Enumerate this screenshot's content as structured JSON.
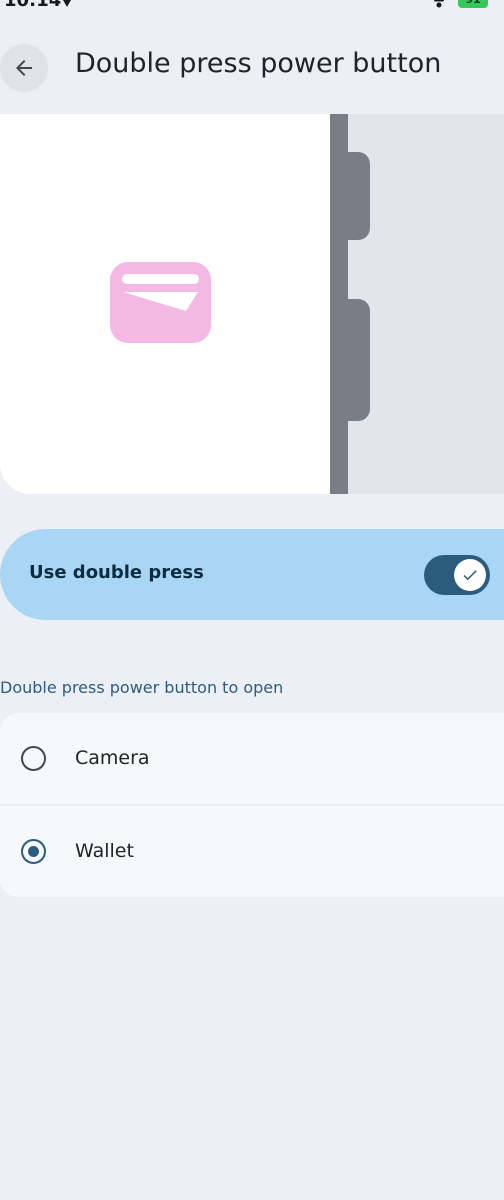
{
  "status_bar": {
    "time": "10:14",
    "battery": "91"
  },
  "header": {
    "title": "Double press power button",
    "back_icon": "arrow-left-icon"
  },
  "illustration": {
    "icon": "wallet-card-icon",
    "colors": {
      "icon_pink": "#f4b8e4",
      "phone_edge": "#777e86",
      "phone_side": "#e2e5ec"
    }
  },
  "toggle": {
    "label": "Use double press",
    "checked": true,
    "thumb_icon": "check-icon"
  },
  "section": {
    "label": "Double press power button to open"
  },
  "options": [
    {
      "label": "Camera",
      "selected": false
    },
    {
      "label": "Wallet",
      "selected": true
    }
  ],
  "colors": {
    "background": "#eceff6",
    "accent": "#2c5c7d",
    "toggle_card": "#a8d6f4"
  }
}
